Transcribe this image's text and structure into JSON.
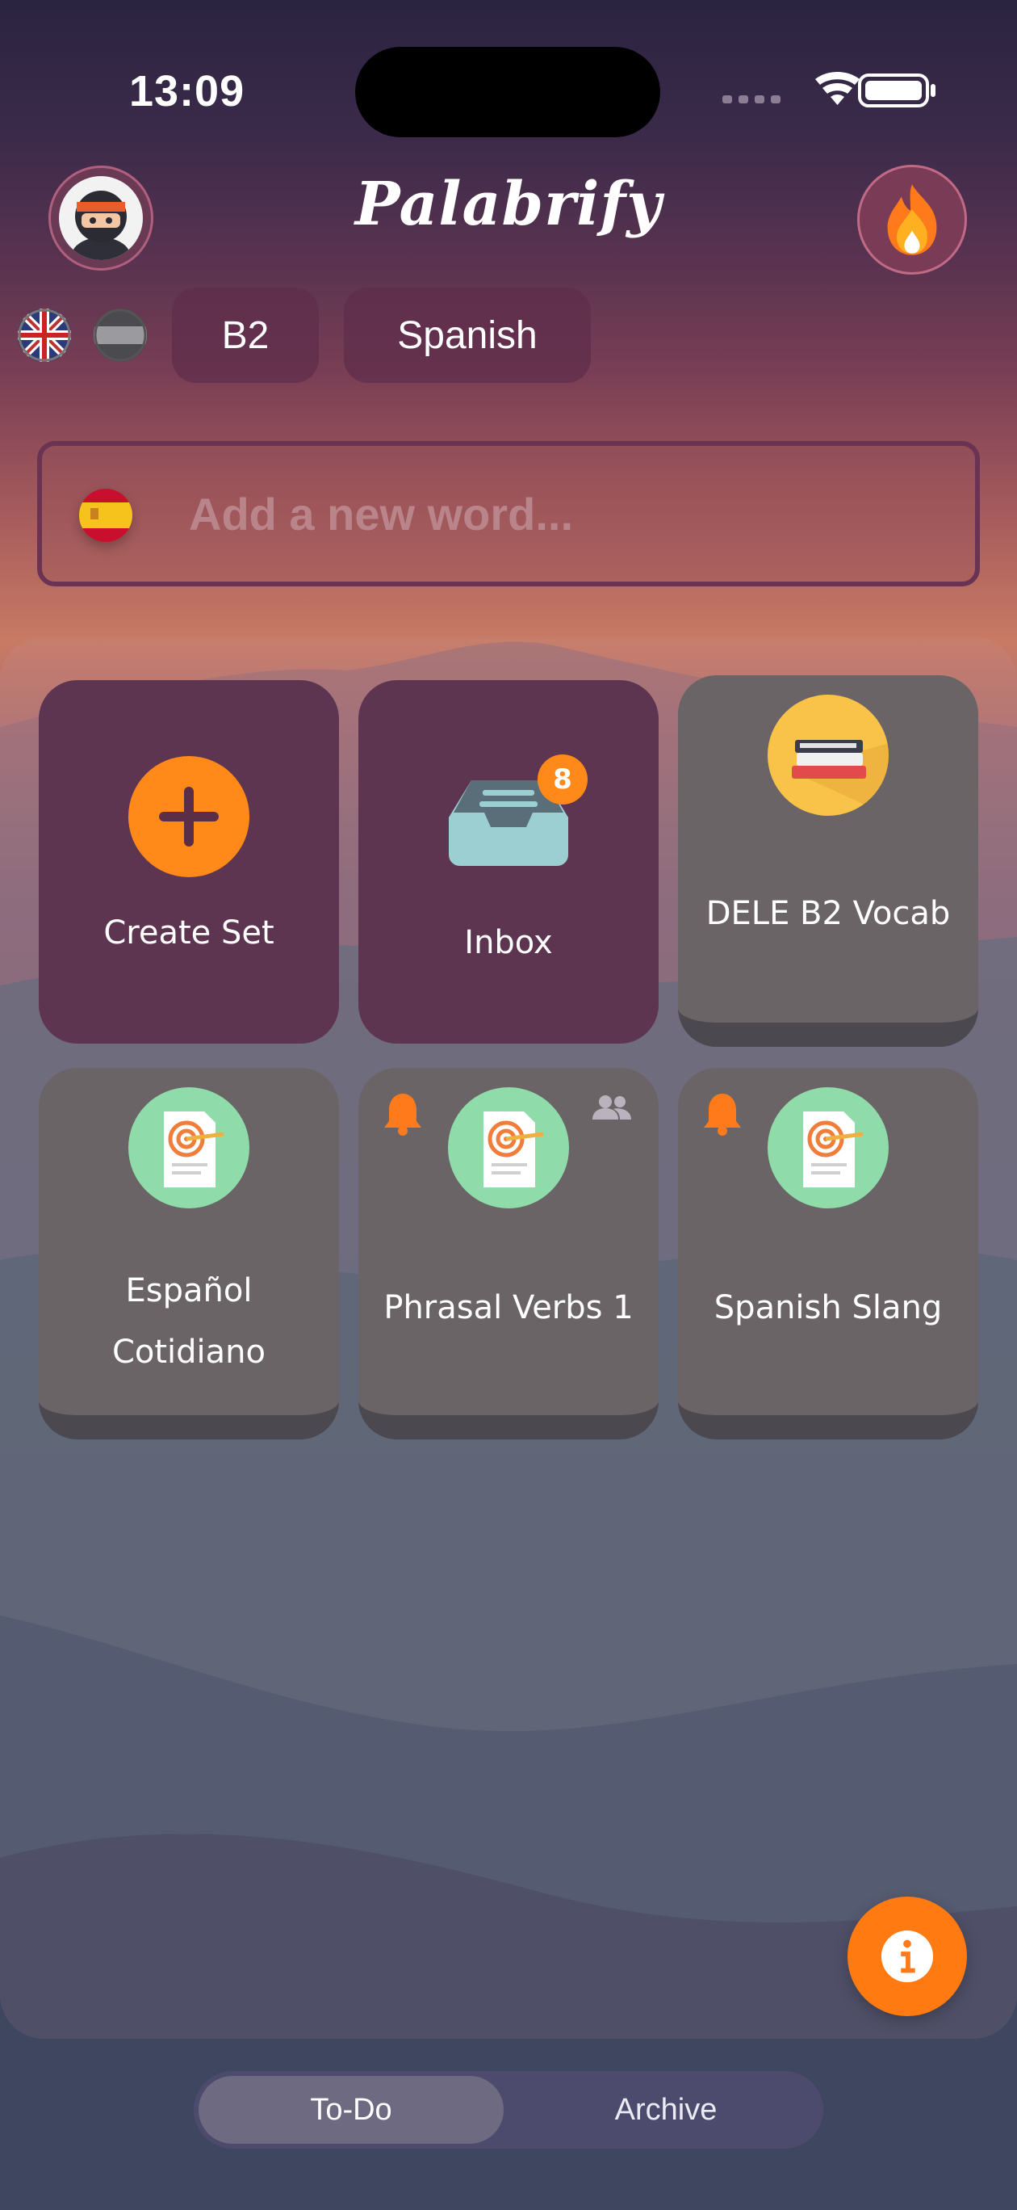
{
  "status_bar": {
    "time": "13:09"
  },
  "header": {
    "app_title": "Palabrify"
  },
  "language_bar": {
    "level": "B2",
    "language": "Spanish"
  },
  "word_input": {
    "placeholder": "Add a new word..."
  },
  "tiles": {
    "create_set": {
      "label": "Create Set"
    },
    "inbox": {
      "label": "Inbox",
      "badge": "8"
    },
    "dele": {
      "label": "DELE B2 Vocab"
    },
    "espanol": {
      "label_line1": "Español",
      "label_line2": "Cotidiano"
    },
    "phrasal": {
      "label": "Phrasal Verbs 1"
    },
    "slang": {
      "label": "Spanish Slang"
    }
  },
  "bottom_tabs": {
    "todo": "To-Do",
    "archive": "Archive",
    "selected": "To-Do"
  },
  "colors": {
    "accent": "#ff8a1a",
    "tile_dark": "#5e3550",
    "tile_grey": "#6b6466",
    "target_bg": "#8fdcaa"
  },
  "icons": [
    "ninja-avatar",
    "flame-icon",
    "uk-flag",
    "grey-flag",
    "spain-flag",
    "plus-icon",
    "inbox-tray-icon",
    "books-icon",
    "target-document-icon",
    "bell-icon",
    "people-icon",
    "info-icon"
  ]
}
